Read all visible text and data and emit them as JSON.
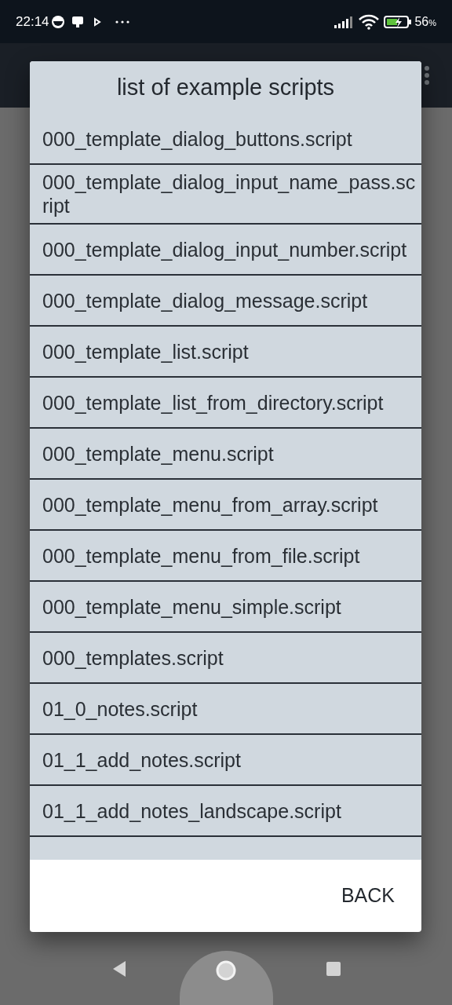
{
  "status_bar": {
    "time": "22:14",
    "battery": "56",
    "battery_unit": "%"
  },
  "dialog": {
    "title": "list of example scripts",
    "items": [
      "000_template_dialog_buttons.script",
      "000_template_dialog_input_name_pass.script",
      "000_template_dialog_input_number.script",
      "000_template_dialog_message.script",
      "000_template_list.script",
      "000_template_list_from_directory.script",
      "000_template_menu.script",
      "000_template_menu_from_array.script",
      "000_template_menu_from_file.script",
      "000_template_menu_simple.script",
      "000_templates.script",
      "01_0_notes.script",
      "01_1_add_notes.script",
      "01_1_add_notes_landscape.script"
    ],
    "buttons": [
      "BACK"
    ]
  }
}
